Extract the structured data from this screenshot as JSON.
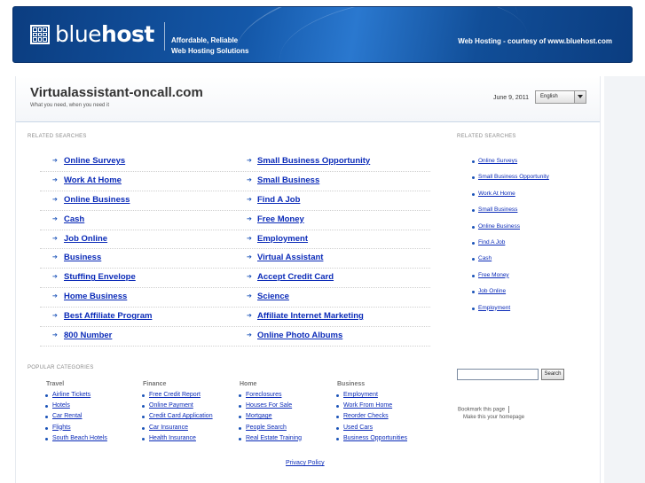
{
  "header": {
    "logo_light": "blue",
    "logo_bold": "host",
    "tagline_line1": "Affordable, Reliable",
    "tagline_line2": "Web Hosting Solutions",
    "right_text": "Web Hosting - courtesy of www.bluehost.com"
  },
  "site": {
    "title": "Virtualassistant-oncall.com",
    "subtitle": "What you need, when you need it",
    "date": "June 9, 2011",
    "language": "English"
  },
  "related_label": "RELATED SEARCHES",
  "related": [
    [
      "Online Surveys",
      "Small Business Opportunity"
    ],
    [
      "Work At Home",
      "Small Business"
    ],
    [
      "Online Business",
      "Find A Job"
    ],
    [
      "Cash",
      "Free Money"
    ],
    [
      "Job Online",
      "Employment"
    ],
    [
      "Business",
      "Virtual Assistant"
    ],
    [
      "Stuffing Envelope",
      "Accept Credit Card"
    ],
    [
      "Home Business",
      "Science"
    ],
    [
      "Best Affiliate Program",
      "Affiliate Internet Marketing"
    ],
    [
      "800 Number",
      "Online Photo Albums"
    ]
  ],
  "sidebar_label": "RELATED SEARCHES",
  "sidebar_related": [
    "Online Surveys",
    "Small Business Opportunity",
    "Work At Home",
    "Small Business",
    "Online Business",
    "Find A Job",
    "Cash",
    "Free Money",
    "Job Online",
    "Employment"
  ],
  "popular_label": "POPULAR CATEGORIES",
  "popular": [
    {
      "heading": "Travel",
      "items": [
        "Airline Tickets",
        "Hotels",
        "Car Rental",
        "Flights",
        "South Beach Hotels"
      ]
    },
    {
      "heading": "Finance",
      "items": [
        "Free Credit Report",
        "Online Payment",
        "Credit Card Application",
        "Car Insurance",
        "Health Insurance"
      ]
    },
    {
      "heading": "Home",
      "items": [
        "Foreclosures",
        "Houses For Sale",
        "Mortgage",
        "People Search",
        "Real Estate Training"
      ]
    },
    {
      "heading": "Business",
      "items": [
        "Employment",
        "Work From Home",
        "Reorder Checks",
        "Used Cars",
        "Business Opportunities"
      ]
    }
  ],
  "search": {
    "button_label": "Search",
    "value": ""
  },
  "bookmark_label": "Bookmark this page",
  "homepage_label": "Make this your homepage",
  "privacy_label": "Privacy Policy",
  "colors": {
    "link": "#0b2bb8",
    "header_blue": "#1458a9",
    "bullet": "#1a52b8"
  }
}
